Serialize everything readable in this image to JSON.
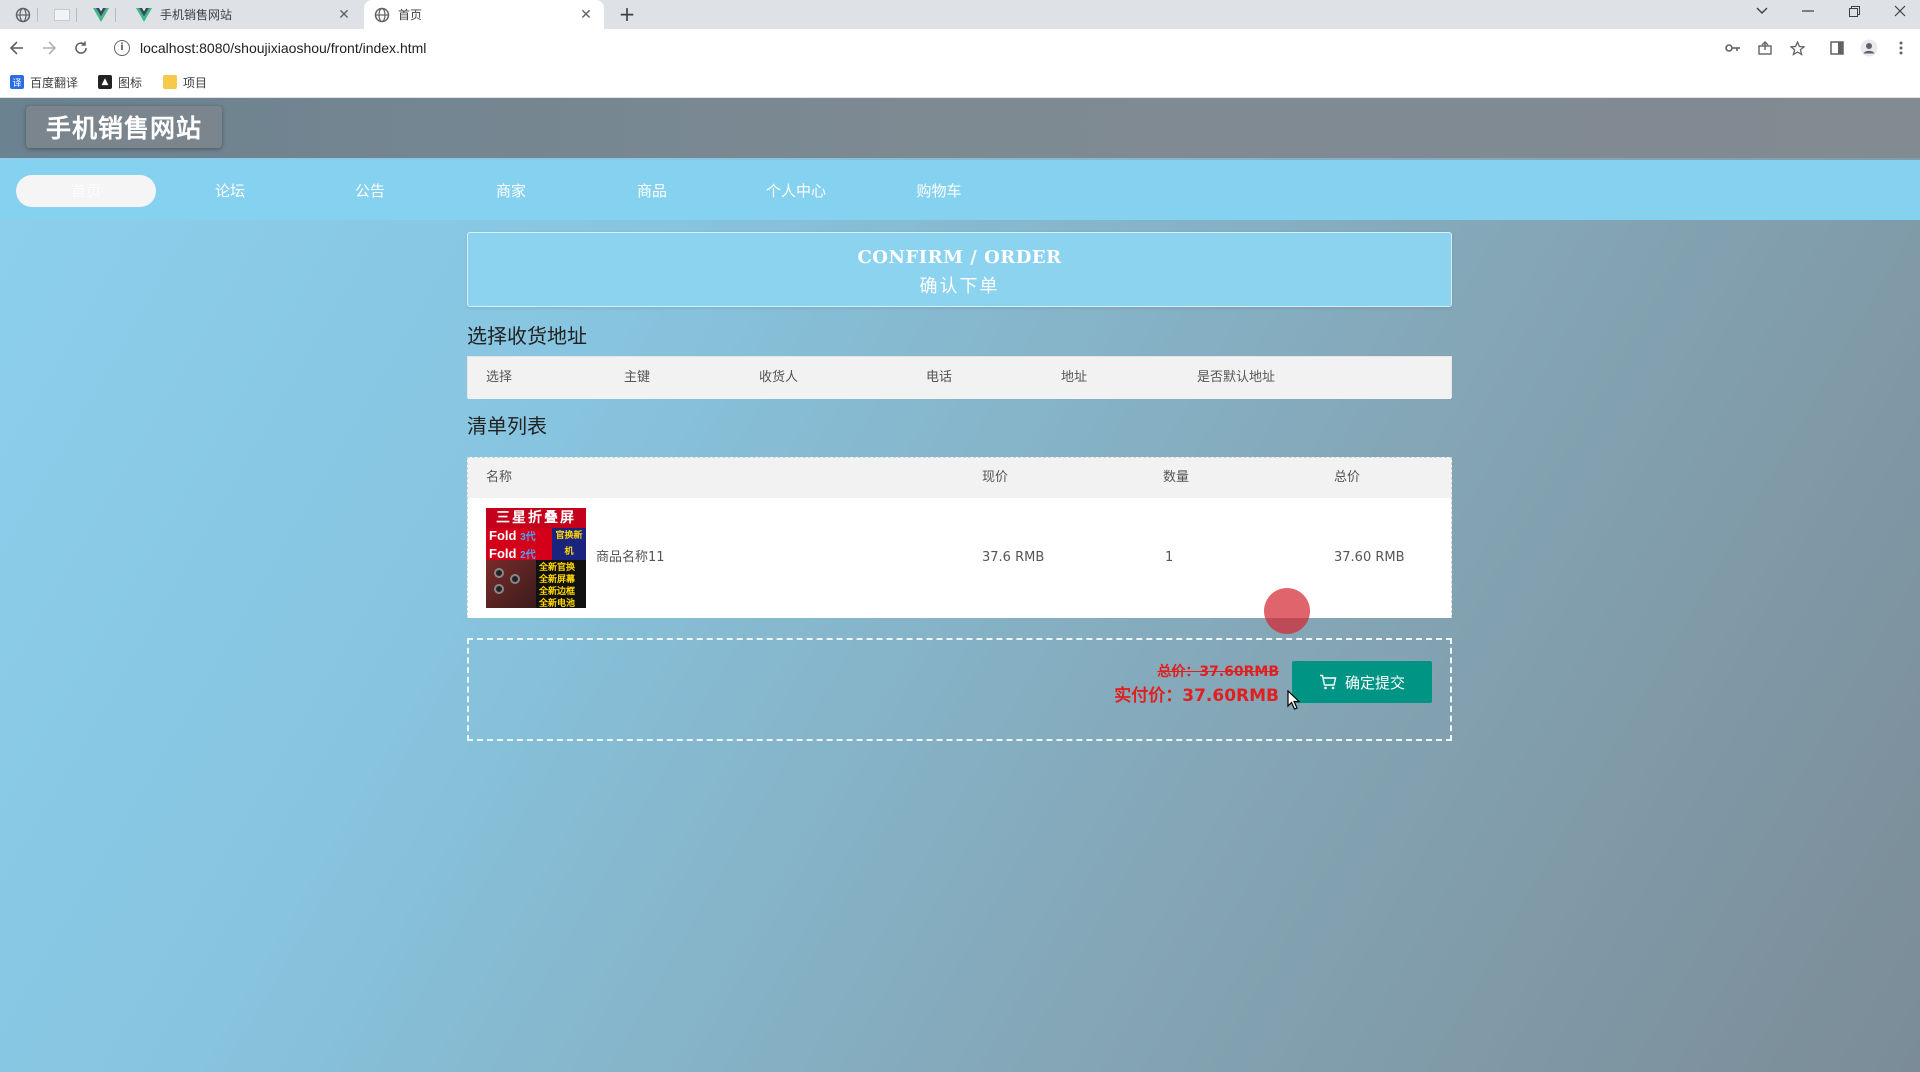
{
  "browser": {
    "tabs": [
      {
        "title": "手机销售网站",
        "close": "✕",
        "active": false
      },
      {
        "title": "首页",
        "close": "✕",
        "active": true
      }
    ],
    "new_tab": "+",
    "url": "localhost:8080/shoujixiaoshou/front/index.html",
    "bookmarks": [
      {
        "label": "百度翻译",
        "icon": "translate-icon"
      },
      {
        "label": "图标",
        "icon": "image-icon"
      },
      {
        "label": "项目",
        "icon": "folder-icon"
      }
    ]
  },
  "site": {
    "logo": "手机销售网站",
    "nav": [
      "首页",
      "论坛",
      "公告",
      "商家",
      "商品",
      "个人中心",
      "购物车"
    ],
    "active_nav": "首页"
  },
  "order": {
    "banner_en": "CONFIRM / ORDER",
    "banner_zh": "确认下单",
    "address_title": "选择收货地址",
    "address_columns": [
      "选择",
      "主键",
      "收货人",
      "电话",
      "地址",
      "是否默认地址"
    ],
    "list_title": "清单列表",
    "item_columns": [
      "名称",
      "现价",
      "数量",
      "总价"
    ],
    "items": [
      {
        "name": "商品名称11",
        "price": "37.6 RMB",
        "quantity": "1",
        "total": "37.60 RMB",
        "thumb_text": {
          "headline": "三星折叠屏",
          "line1": "Fold",
          "line1_gen": "3代",
          "line2": "Fold",
          "line2_gen": "2代",
          "badge": "官换新机",
          "tags": "全新官换 全新屏幕 全新边框 全新电池"
        }
      }
    ],
    "total_label": "总价：37.60RMB",
    "paid_label": "实付价：37.60RMB",
    "submit_label": "确定提交"
  },
  "colors": {
    "navbar": "#85d1f0",
    "header": "#7e8a92",
    "submit": "#009485",
    "price": "#e02020"
  }
}
